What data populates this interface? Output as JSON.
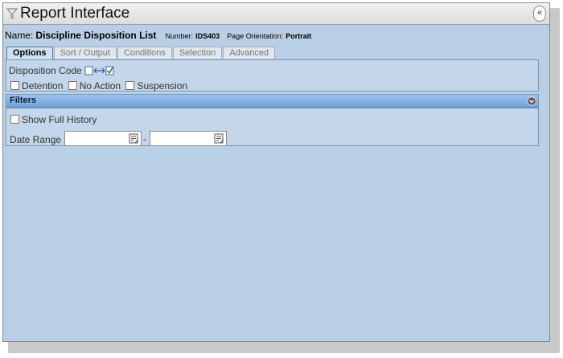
{
  "window": {
    "title": "Report Interface",
    "collapse_label": "«"
  },
  "report": {
    "name_label": "Name:",
    "name": "Discipline Disposition List",
    "number_label": "Number:",
    "number": "IDS403",
    "orientation_label": "Page Orientation:",
    "orientation": "Portrait"
  },
  "tabs": [
    {
      "label": "Options",
      "active": true
    },
    {
      "label": "Sort / Output",
      "active": false
    },
    {
      "label": "Conditions",
      "active": false
    },
    {
      "label": "Selection",
      "active": false
    },
    {
      "label": "Advanced",
      "active": false
    }
  ],
  "options": {
    "disposition_code_label": "Disposition Code",
    "checkboxes": [
      {
        "label": "Detention",
        "checked": false
      },
      {
        "label": "No Action",
        "checked": false
      },
      {
        "label": "Suspension",
        "checked": false
      }
    ]
  },
  "filters": {
    "title": "Filters",
    "show_full_history": {
      "label": "Show Full History",
      "checked": false
    },
    "date_range_label": "Date Range",
    "date_separator": "-",
    "date_from": "",
    "date_to": ""
  },
  "colors": {
    "panel_bg": "#b9cfe6",
    "filters_header": "#6e9fd4"
  },
  "icons": {
    "title": "filter-funnel-icon",
    "code_picker": "select-toggle-icon",
    "calendar": "calendar-icon",
    "filters_toggle": "circle-arrow-icon"
  }
}
